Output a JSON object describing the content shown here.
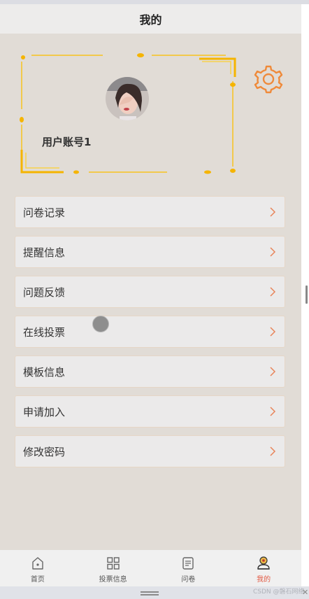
{
  "header": {
    "title": "我的"
  },
  "profile": {
    "username": "用户账号1"
  },
  "menu": {
    "items": [
      {
        "label": "问卷记录"
      },
      {
        "label": "提醒信息"
      },
      {
        "label": "问题反馈"
      },
      {
        "label": "在线投票"
      },
      {
        "label": "模板信息"
      },
      {
        "label": "申请加入"
      },
      {
        "label": "修改密码"
      }
    ]
  },
  "tabbar": {
    "tabs": [
      {
        "label": "首页",
        "icon": "home-icon"
      },
      {
        "label": "投票信息",
        "icon": "grid-icon"
      },
      {
        "label": "问卷",
        "icon": "document-icon"
      },
      {
        "label": "我的",
        "icon": "user-icon",
        "active": true
      }
    ]
  },
  "watermark": "CSDN @磐石网络",
  "colors": {
    "accent": "#e25b45",
    "gear": "#ef8a3a",
    "frame": "#f2b400"
  }
}
